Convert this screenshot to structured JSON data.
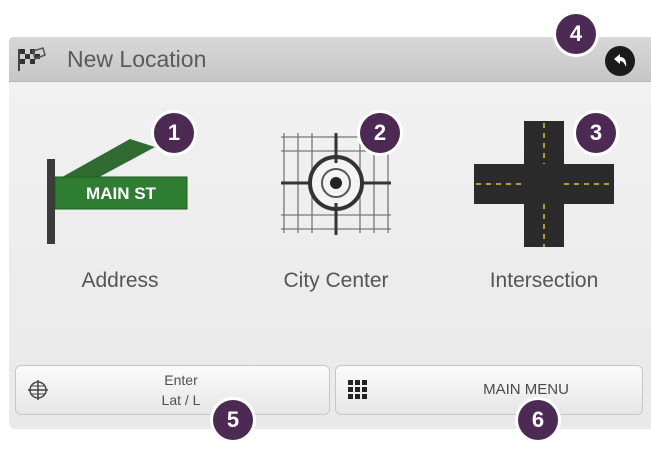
{
  "header": {
    "title": "New Location",
    "flag_icon": "checkered-flag-icon",
    "back_icon": "back-arrow-icon"
  },
  "options": [
    {
      "label": "Address",
      "sign_text": "MAIN ST",
      "icon": "street-sign-icon"
    },
    {
      "label": "City Center",
      "icon": "crosshair-target-icon"
    },
    {
      "label": "Intersection",
      "icon": "road-intersection-icon"
    }
  ],
  "bottom": {
    "latlon_line1": "Enter",
    "latlon_line2": "Lat / L",
    "latlon_icon": "globe-grid-icon",
    "main_menu_label": "MAIN MENU",
    "main_menu_icon": "grid-menu-icon"
  },
  "callouts": [
    "1",
    "2",
    "3",
    "4",
    "5",
    "6"
  ],
  "colors": {
    "callout": "#4c2a53",
    "sign_green": "#2e7d32"
  }
}
